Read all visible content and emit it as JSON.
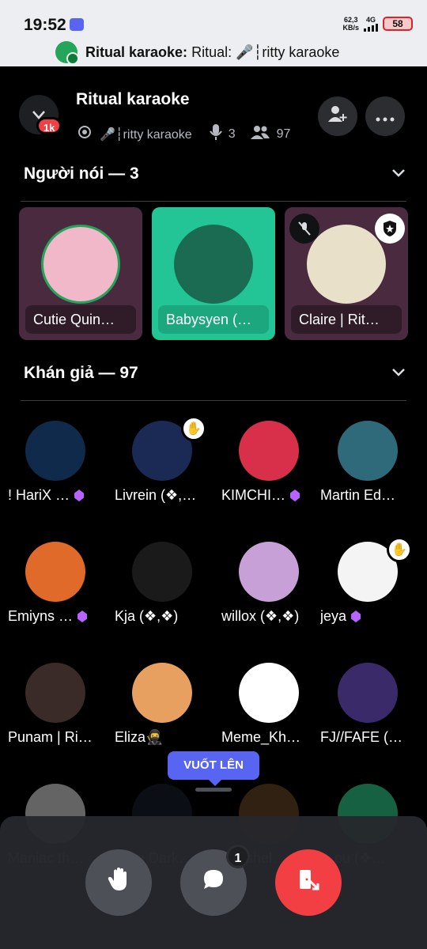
{
  "status_bar": {
    "time": "19:52",
    "speed_value": "62,3",
    "speed_unit": "KB/s",
    "network": "4G",
    "battery": "58",
    "call_title": "Ritual karaoke:",
    "call_subtitle": "Ritual: 🎤┆ritty karaoke"
  },
  "header": {
    "title": "Ritual karaoke",
    "badge": "1k",
    "channel": "🎤┆ritty karaoke",
    "speakers_count": "3",
    "listeners_count": "97"
  },
  "speakers_section": {
    "title": "Người nói — 3",
    "cards": [
      {
        "name": "Cutie Quin…",
        "bg": "#4a2a3f",
        "avatar_color": "#f0b8c8"
      },
      {
        "name": "Babysyen (…",
        "bg": "#23c596",
        "avatar_color": "#1a6b52"
      },
      {
        "name": "Claire | Rit…",
        "bg": "#4a2a3f",
        "avatar_color": "#e8e0c8"
      }
    ]
  },
  "audience_section": {
    "title": "Khán giả — 97",
    "members": [
      {
        "name": "! HariX …",
        "gem": true,
        "hand": false,
        "color": "#0f2a4a"
      },
      {
        "name": "Livrein (❖,…",
        "gem": false,
        "hand": true,
        "color": "#1a2a55"
      },
      {
        "name": "KIMCHI…",
        "gem": true,
        "hand": false,
        "color": "#d8304a"
      },
      {
        "name": "Martin Ed…",
        "gem": false,
        "hand": false,
        "color": "#2f6a7a"
      },
      {
        "name": "Emiyns …",
        "gem": true,
        "hand": false,
        "color": "#e06a2a"
      },
      {
        "name": "Kja (❖,❖)",
        "gem": false,
        "hand": false,
        "color": "#1a1a1a"
      },
      {
        "name": "willox (❖,❖)",
        "gem": false,
        "hand": false,
        "color": "#c8a0d8"
      },
      {
        "name": "jeya",
        "gem": true,
        "hand": true,
        "color": "#f4f4f4"
      },
      {
        "name": "Punam | Ri…",
        "gem": false,
        "hand": false,
        "color": "#3a2a28"
      },
      {
        "name": "Eliza🥷",
        "gem": false,
        "hand": false,
        "color": "#e8a060"
      },
      {
        "name": "Meme_Kh…",
        "gem": false,
        "hand": false,
        "color": "#ffffff"
      },
      {
        "name": "FJ//FAFE (…",
        "gem": false,
        "hand": false,
        "color": "#3a2a6a"
      },
      {
        "name": "Maniac th…",
        "gem": false,
        "hand": false,
        "color": "#dddddd"
      },
      {
        "name": "Nam Dark…",
        "gem": false,
        "hand": false,
        "color": "#1a2030"
      },
      {
        "name": "Ashshel…",
        "gem": false,
        "hand": false,
        "color": "#6a4a2a"
      },
      {
        "name": "…pu (❖…",
        "gem": false,
        "hand": false,
        "color": "#30d890"
      }
    ]
  },
  "tooltip": "VUỐT LÊN",
  "controls": {
    "chat_badge": "1",
    "colors": {
      "raise_hand": "#4e5058",
      "chat": "#4e5058",
      "leave": "#f23f43"
    }
  },
  "icons": [
    "discord-icon",
    "call-icon",
    "chevron-down-icon",
    "broadcast-icon",
    "microphone-icon",
    "users-icon",
    "add-user-icon",
    "more-icon",
    "muted-mic-icon",
    "moderator-shield-icon",
    "gem-icon",
    "raise-hand-icon",
    "chat-icon",
    "leave-icon"
  ]
}
